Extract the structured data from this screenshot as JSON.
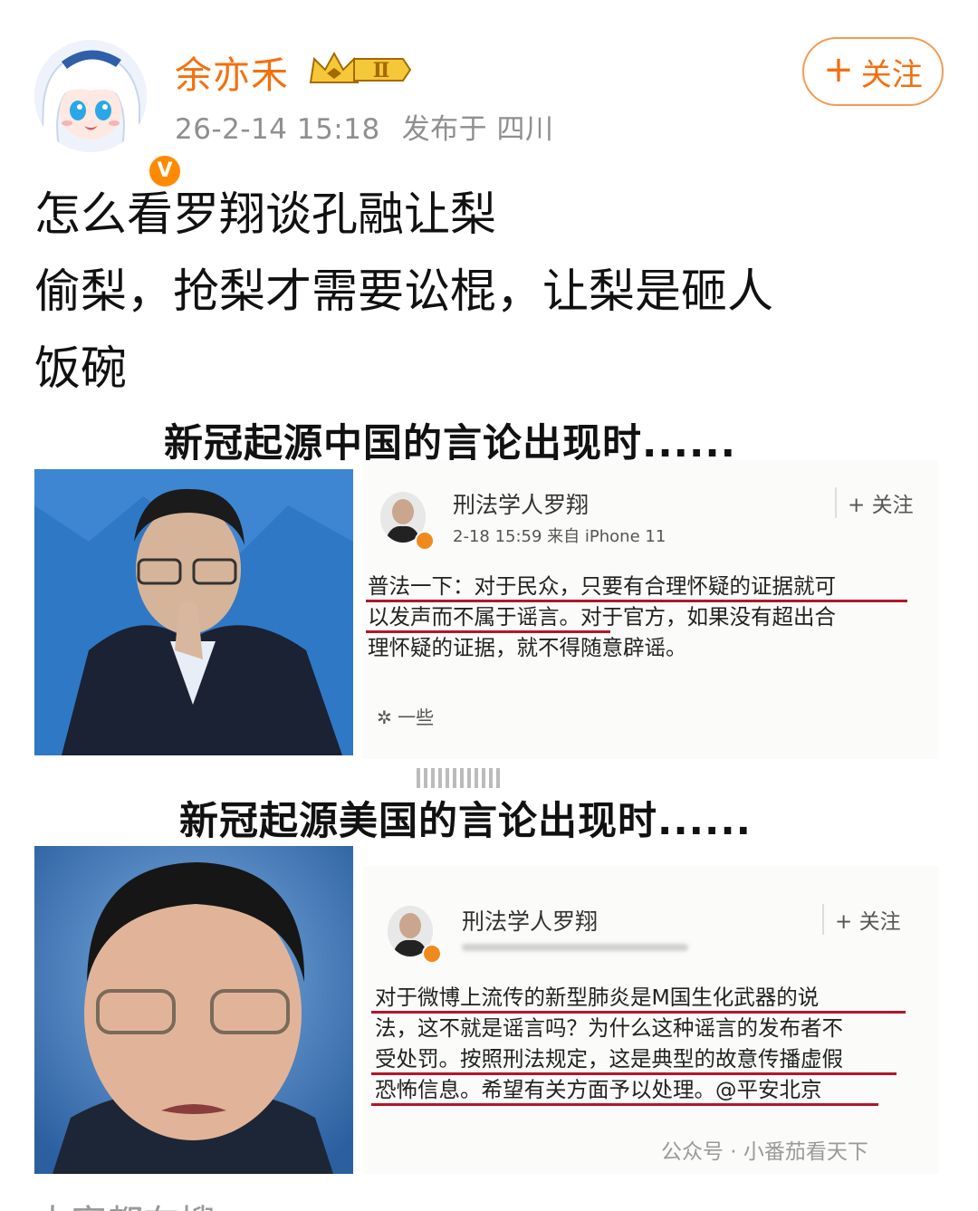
{
  "post": {
    "username": "余亦禾",
    "member_level": "Ⅱ",
    "timestamp": "26-2-14 15:18",
    "location": "发布于 四川",
    "follow_label": "关注",
    "verified_badge": "V",
    "text_lines": [
      "怎么看罗翔谈孔融让梨",
      "偷梨，抢梨才需要讼棍，让梨是砸人",
      "饭碗"
    ]
  },
  "image": {
    "caption_top": "新冠起源中国的言论出现时......",
    "caption_bottom": "新冠起源美国的言论出现时......",
    "card1": {
      "name": "刑法学人罗翔",
      "meta": "2-18 15:59  来自 iPhone 11",
      "follow_label": "+ 关注",
      "body_lines": [
        "普法一下：对于民众，只要有合理怀疑的证据就可",
        "以发声而不属于谣言。对于官方，如果没有超出合",
        "理怀疑的证据，就不得随意辟谣。"
      ],
      "footer": "一些"
    },
    "card2": {
      "name": "刑法学人罗翔",
      "follow_label": "+ 关注",
      "body_lines": [
        "对于微博上流传的新型肺炎是M国生化武器的说",
        "法，这不就是谣言吗？为什么这种谣言的发布者不",
        "受处罚。按照刑法规定，这是典型的故意传播虚假",
        "恐怖信息。希望有关方面予以处理。@平安北京"
      ],
      "watermark": "公众号 · 小番茄看天下"
    }
  },
  "next_post_peek": "大家都在搜"
}
